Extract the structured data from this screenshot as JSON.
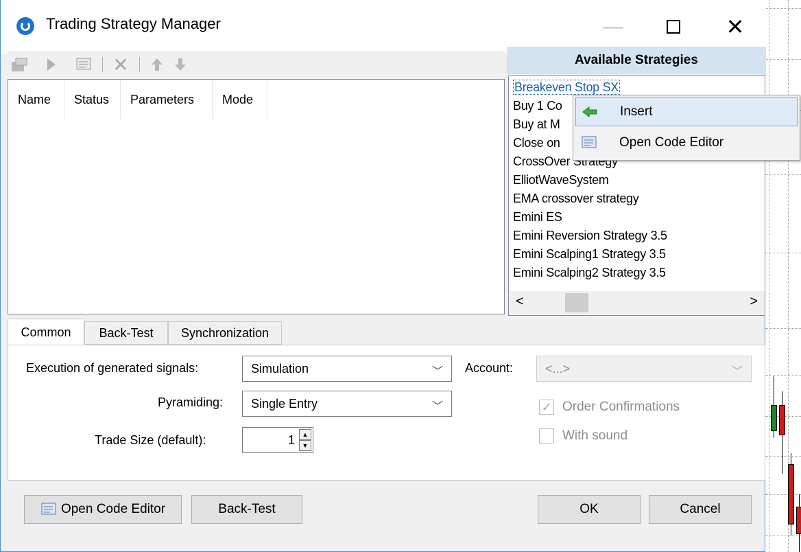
{
  "window": {
    "title": "Trading Strategy Manager",
    "minimize_icon": "minimize-icon",
    "maximize_icon": "maximize-icon",
    "close_icon": "close-icon"
  },
  "toolbar": {
    "icons": [
      "properties-icon",
      "play-icon",
      "code-editor-icon",
      "delete-icon",
      "move-up-icon",
      "move-down-icon"
    ]
  },
  "strategies_table": {
    "columns": [
      "Name",
      "Status",
      "Parameters",
      "Mode"
    ]
  },
  "available_strategies": {
    "header": "Available Strategies",
    "items": [
      "Breakeven Stop SX",
      "Buy 1 Co",
      "Buy at M",
      "Close on",
      "CrossOver Strategy",
      "ElliotWaveSystem",
      "EMA crossover strategy",
      "Emini ES",
      "Emini Reversion Strategy 3.5",
      "Emini Scalping1 Strategy 3.5",
      "Emini Scalping2 Strategy 3.5"
    ],
    "selected_index": 0,
    "scroll_left": "<",
    "scroll_right": ">"
  },
  "context_menu": {
    "items": [
      {
        "label": "Insert",
        "icon": "green-arrow-left-icon"
      },
      {
        "label": "Open Code Editor",
        "icon": "code-editor-icon"
      }
    ]
  },
  "tabs": [
    "Common",
    "Back-Test",
    "Synchronization"
  ],
  "common": {
    "execution_label": "Execution of generated signals:",
    "execution_value": "Simulation",
    "pyramiding_label": "Pyramiding:",
    "pyramiding_value": "Single Entry",
    "trade_size_label": "Trade Size (default):",
    "trade_size_value": "1",
    "account_label": "Account:",
    "account_value": "<...>",
    "order_confirmations_label": "Order Confirmations",
    "order_confirmations_checked": true,
    "with_sound_label": "With sound",
    "with_sound_checked": false
  },
  "buttons": {
    "open_code_editor": "Open Code Editor",
    "back_test": "Back-Test",
    "ok": "OK",
    "cancel": "Cancel"
  },
  "colors": {
    "accent": "#1e73c8",
    "selection_text": "#1e5fb0",
    "header_bg": "#d4e3f2",
    "candle_up": "#1b8a2a",
    "candle_down": "#c81e1e"
  }
}
